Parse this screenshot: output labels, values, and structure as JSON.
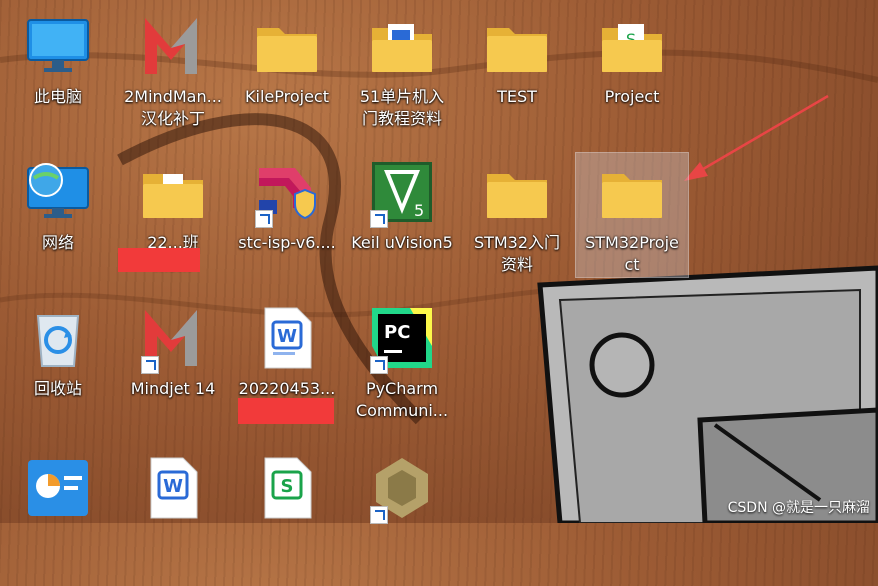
{
  "desktop": {
    "icons": [
      {
        "label": "此电脑",
        "icon": "monitor-icon"
      },
      {
        "label": "2MindMan...\n汉化补丁",
        "icon": "mindmanager-icon"
      },
      {
        "label": "KileProject",
        "icon": "folder-icon"
      },
      {
        "label": "51单片机入\n门教程资料",
        "icon": "folder-doc-icon"
      },
      {
        "label": "TEST",
        "icon": "folder-icon"
      },
      {
        "label": "Project",
        "icon": "folder-doc-icon"
      },
      {
        "label": "网络",
        "icon": "network-icon"
      },
      {
        "label": "22...班\n...s...",
        "icon": "folder-icon"
      },
      {
        "label": "stc-isp-v6....",
        "icon": "stc-isp-icon"
      },
      {
        "label": "Keil uVision5",
        "icon": "keil-icon"
      },
      {
        "label": "STM32入门\n资料",
        "icon": "folder-icon"
      },
      {
        "label": "STM32Proje\nct",
        "icon": "folder-icon"
      },
      {
        "label": "回收站",
        "icon": "recycle-bin-icon"
      },
      {
        "label": "Mindjet 14",
        "icon": "mindjet-icon"
      },
      {
        "label": "20220453...",
        "icon": "word-doc-icon"
      },
      {
        "label": "PyCharm\nCommuni...",
        "icon": "pycharm-icon"
      }
    ],
    "watermark": "CSDN @就是一只麻溜"
  },
  "colors": {
    "folder": "#f6c94f",
    "folder_dark": "#e6b136",
    "arrow": "#e84545",
    "wood": "#9c5b34"
  }
}
